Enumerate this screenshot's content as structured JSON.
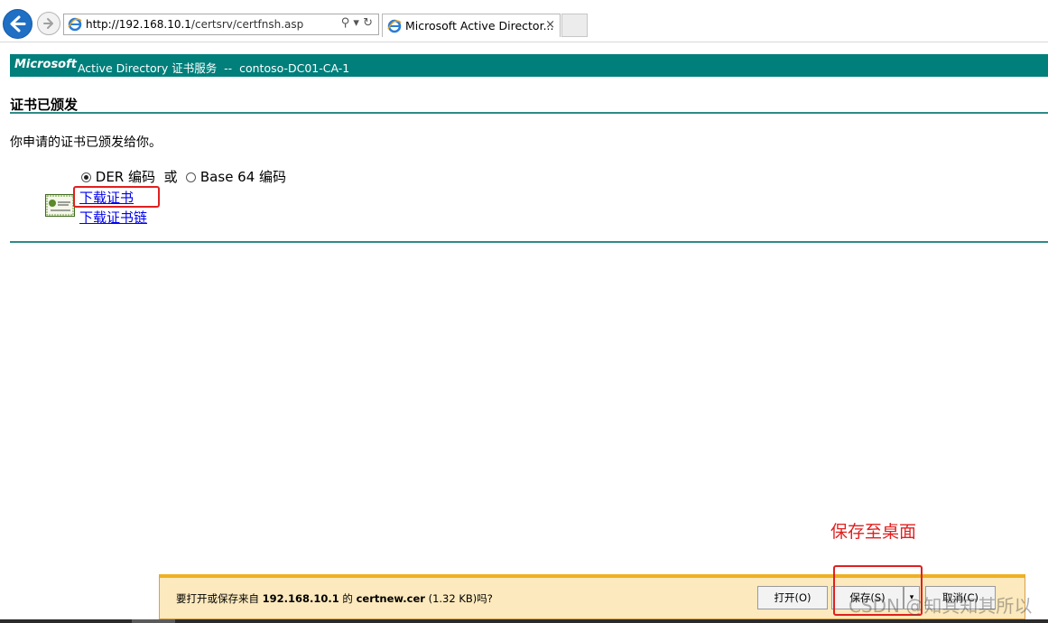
{
  "browser": {
    "address_url_host": "http://192.168.10.1",
    "address_url_path": "/certsrv/certfnsh.asp",
    "address_tools": "⚲ ▾ ↻",
    "tab_title": "Microsoft Active Director...",
    "tab_close": "×"
  },
  "banner": {
    "brand": "Microsoft",
    "text": " Active Directory 证书服务  --  contoso-DC01-CA-1"
  },
  "page": {
    "heading": "证书已颁发",
    "issued_message": "你申请的证书已颁发给你。",
    "encoding": {
      "der_label": "DER 编码",
      "or_label": "或",
      "base64_label": "Base 64 编码",
      "selected": "DER"
    },
    "links": {
      "download_cert": "下载证书",
      "download_chain": "下载证书链"
    }
  },
  "annotation": {
    "text": "保存至桌面",
    "color": "#e02020"
  },
  "download_bar": {
    "prompt_prefix": "要打开或保存来自 ",
    "host": "192.168.10.1",
    "of": " 的 ",
    "filename": "certnew.cer",
    "size_suffix": " (1.32 KB)吗?",
    "open_label": "打开(O)",
    "save_label": "保存(S)",
    "save_arrow": "▾",
    "cancel_label": "取消(C)"
  },
  "watermark": "CSDN @知其知其所以",
  "colors": {
    "banner": "#007f7b",
    "rule": "#2f8a86",
    "link": "#0000ee",
    "notification": "#fce9bd"
  }
}
